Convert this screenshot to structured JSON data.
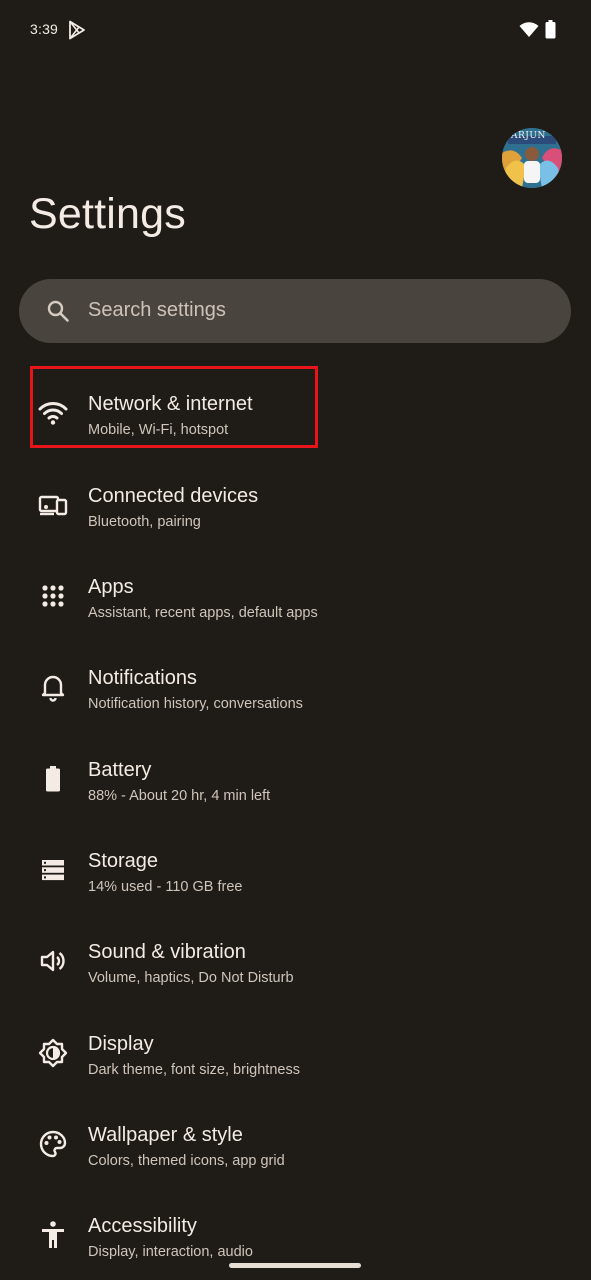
{
  "status_bar": {
    "time": "3:39"
  },
  "header": {
    "title": "Settings",
    "avatar_text": "ARJUN"
  },
  "search": {
    "placeholder": "Search settings"
  },
  "items": [
    {
      "title": "Network & internet",
      "subtitle": "Mobile, Wi-Fi, hotspot",
      "icon": "wifi-icon"
    },
    {
      "title": "Connected devices",
      "subtitle": "Bluetooth, pairing",
      "icon": "devices-icon"
    },
    {
      "title": "Apps",
      "subtitle": "Assistant, recent apps, default apps",
      "icon": "apps-grid-icon"
    },
    {
      "title": "Notifications",
      "subtitle": "Notification history, conversations",
      "icon": "bell-icon"
    },
    {
      "title": "Battery",
      "subtitle": "88% - About 20 hr, 4 min left",
      "icon": "battery-icon"
    },
    {
      "title": "Storage",
      "subtitle": "14% used - 110 GB free",
      "icon": "storage-icon"
    },
    {
      "title": "Sound & vibration",
      "subtitle": "Volume, haptics, Do Not Disturb",
      "icon": "speaker-icon"
    },
    {
      "title": "Display",
      "subtitle": "Dark theme, font size, brightness",
      "icon": "brightness-icon"
    },
    {
      "title": "Wallpaper & style",
      "subtitle": "Colors, themed icons, app grid",
      "icon": "palette-icon"
    },
    {
      "title": "Accessibility",
      "subtitle": "Display, interaction, audio",
      "icon": "accessibility-icon"
    }
  ],
  "colors": {
    "background": "#1f1b17",
    "search_background": "#4a443e",
    "highlight": "#e8141b",
    "text_primary": "#f4ece4",
    "text_secondary": "#cfc5ba"
  }
}
